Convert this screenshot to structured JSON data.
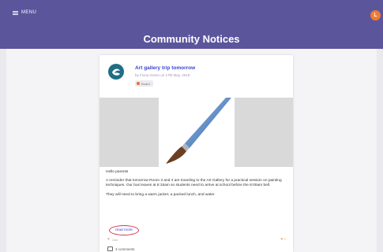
{
  "header": {
    "menu_label": "MENU",
    "page_title": "Community Notices",
    "user_initial": "L",
    "accent_color": "#5b559c"
  },
  "post": {
    "title": "Art gallery trip tomorrow",
    "meta": "by Fiona Green on 17th May, 2019",
    "badge": "Board",
    "image_icon": "paintbrush-icon",
    "greeting": "Hello parents",
    "paragraph": "A reminder that tomorrow Room 3 and 4 are traveling to the Art Gallery for a practical session on painting techniques. Our bus leaves at 8:15am so students need to arrive at school before the 8:00am bell.",
    "paragraph2": "They will need to bring a warm jacket, a packed lunch, and water",
    "read_more": "read more",
    "likes": "Like",
    "flags": "1",
    "comments": "3 comments"
  }
}
